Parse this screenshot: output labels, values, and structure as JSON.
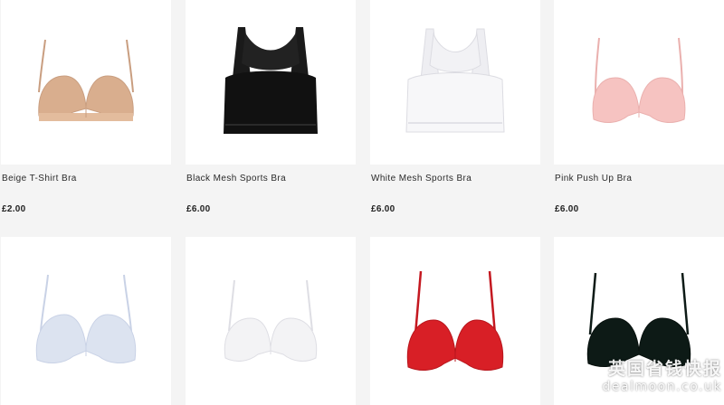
{
  "products": [
    {
      "name": "Beige T-Shirt Bra",
      "price": "£2.00",
      "color": "#d9ae8e"
    },
    {
      "name": "Black Mesh Sports Bra",
      "price": "£6.00",
      "color": "#111111"
    },
    {
      "name": "White Mesh Sports Bra",
      "price": "£6.00",
      "color": "#f6f6f8"
    },
    {
      "name": "Pink Push Up Bra",
      "price": "£6.00",
      "color": "#f6c3c1"
    },
    {
      "name": "",
      "price": "",
      "color": "#dce3f0"
    },
    {
      "name": "",
      "price": "",
      "color": "#f3f3f5"
    },
    {
      "name": "",
      "price": "",
      "color": "#d81f26"
    },
    {
      "name": "",
      "price": "",
      "color": "#0d1a16"
    }
  ],
  "watermark": {
    "line1": "英国省钱快报",
    "line2": "dealmoon.co.uk"
  }
}
